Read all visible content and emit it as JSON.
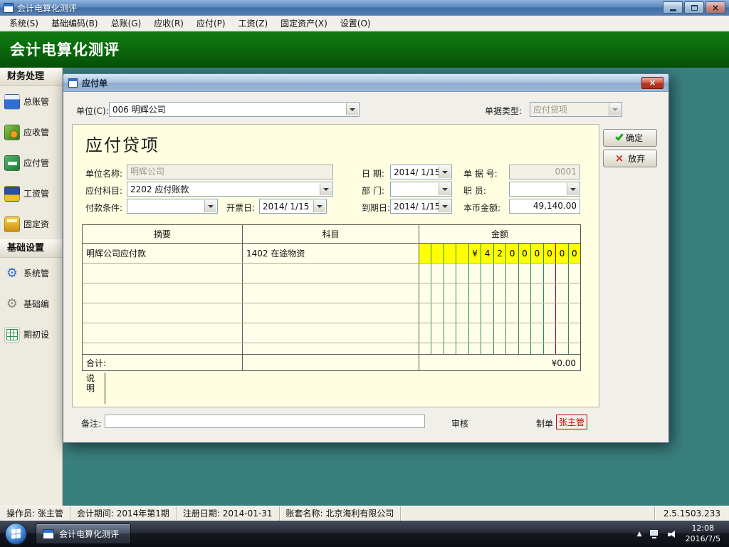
{
  "window": {
    "title": "会计电算化测评"
  },
  "menu": {
    "items": [
      "系统(S)",
      "基础编码(B)",
      "总账(G)",
      "应收(R)",
      "应付(P)",
      "工资(Z)",
      "固定资产(X)",
      "设置(O)"
    ]
  },
  "banner": {
    "title": "会计电算化测评"
  },
  "sidebar": {
    "sections": [
      {
        "header": "财务处理",
        "items": [
          "总账管",
          "应收管",
          "应付管",
          "工资管",
          "固定资"
        ]
      },
      {
        "header": "基础设置",
        "items": [
          "系统管",
          "基础编",
          "期初设"
        ]
      }
    ]
  },
  "dialog": {
    "title": "应付单",
    "unit_label": "单位(C):",
    "unit_value": "006 明辉公司",
    "doc_type_label": "单据类型:",
    "doc_type_value": "应付贷项",
    "panel": {
      "title": "应付贷项",
      "unit_name_label": "单位名称:",
      "unit_name_value": "明辉公司",
      "date_label": "日  期:",
      "date_value": "2014/ 1/15",
      "doc_no_label": "单 据 号:",
      "doc_no_value": "0001",
      "account_label": "应付科目:",
      "account_value": "2202 应付账款",
      "dept_label": "部  门:",
      "staff_label": "职  员:",
      "terms_label": "付款条件:",
      "invoice_date_label": "开票日:",
      "invoice_date_value": "2014/ 1/15",
      "due_date_label": "到期日:",
      "due_date_value": "2014/ 1/15",
      "amount_label": "本币金额:",
      "amount_value": "49,140.00",
      "table": {
        "headers": [
          "摘要",
          "科目",
          "金额"
        ],
        "row1": {
          "summary": "明辉公司应付款",
          "account": "1402 在途物资",
          "digits": [
            "¥",
            "4",
            "2",
            "0",
            "0",
            "0",
            "0",
            "0",
            "0"
          ]
        },
        "total_label": "合计:",
        "total_value": "¥0.00"
      },
      "note_line1": "说",
      "note_line2": "明"
    },
    "remark_label": "备注:",
    "review_label": "审核",
    "maker_label": "制单",
    "maker_value": "张主管",
    "ok_label": "确定",
    "cancel_label": "放弃"
  },
  "statusbar": {
    "operator": "操作员: 张主管",
    "period": "会计期间: 2014年第1期",
    "reg_date": "注册日期: 2014-01-31",
    "account_set": "账套名称: 北京海利有限公司",
    "version": "2.5.1503.233"
  },
  "taskbar": {
    "app_title": "会计电算化测评",
    "time": "12:08",
    "date": "2016/7/5"
  },
  "icons": {
    "close": "×",
    "cancel": "×",
    "tray_up": "▲",
    "gear": "⚙"
  },
  "colors": {
    "banner_green": "#0a660c",
    "highlight_yellow": "#ffff00",
    "maker_red": "#cc0000",
    "desktop_teal": "#3a7f7f"
  }
}
